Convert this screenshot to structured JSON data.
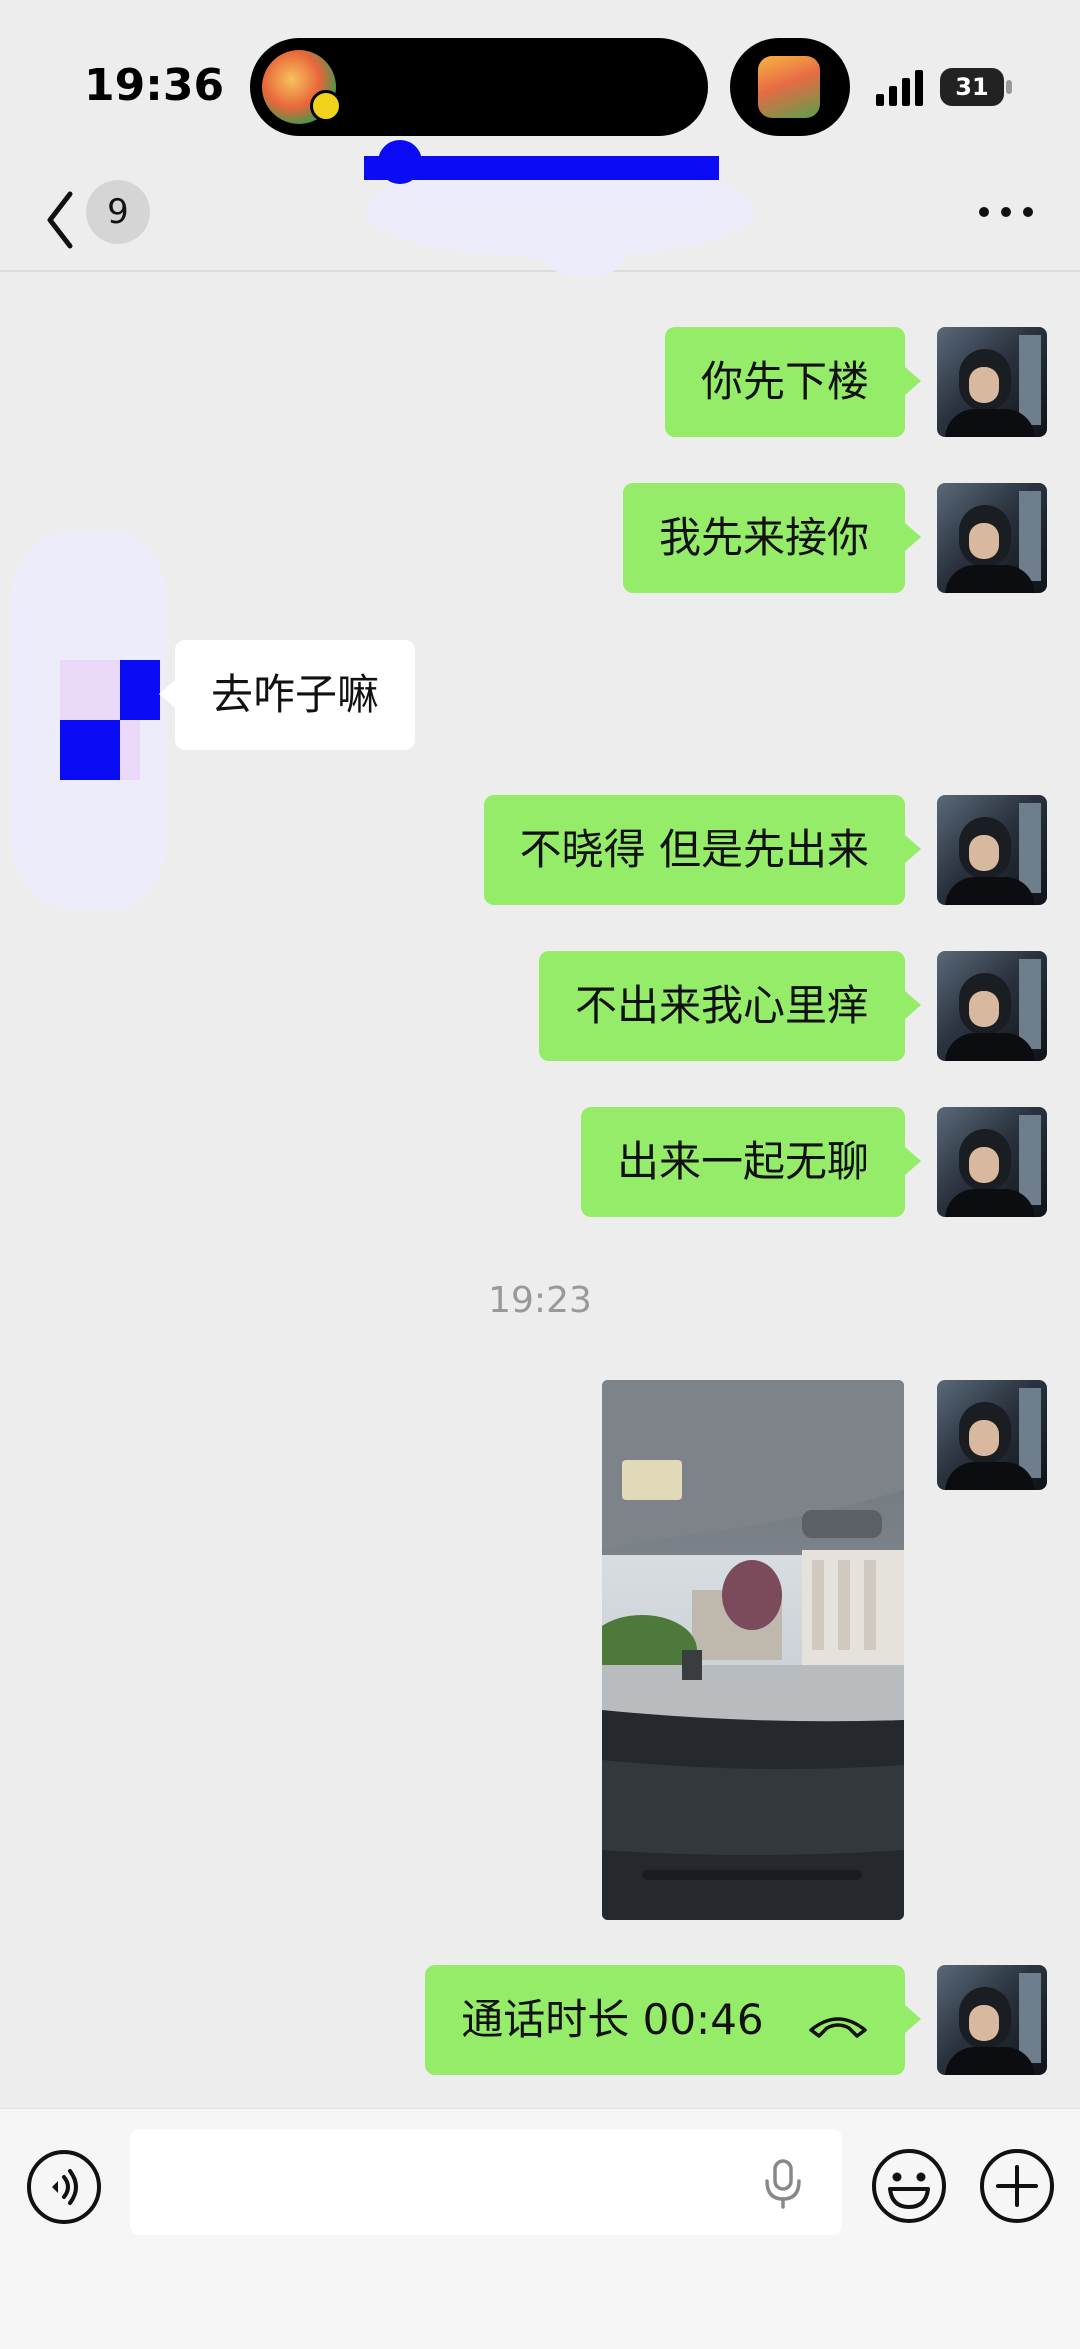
{
  "status_bar": {
    "time": "19:36",
    "battery": "31"
  },
  "nav": {
    "unread_count": "9"
  },
  "messages": [
    {
      "direction": "out",
      "text": "你先下楼"
    },
    {
      "direction": "out",
      "text": "我先来接你"
    },
    {
      "direction": "in",
      "text": "去咋子嘛"
    },
    {
      "direction": "out",
      "text": "不晓得 但是先出来"
    },
    {
      "direction": "out",
      "text": "不出来我心里痒"
    },
    {
      "direction": "out",
      "text": "出来一起无聊"
    }
  ],
  "timestamp": "19:23",
  "call": {
    "text": "通话时长 00:46"
  },
  "colors": {
    "background": "#ededed",
    "outgoing_bubble": "#95ec69",
    "incoming_bubble": "#ffffff"
  }
}
